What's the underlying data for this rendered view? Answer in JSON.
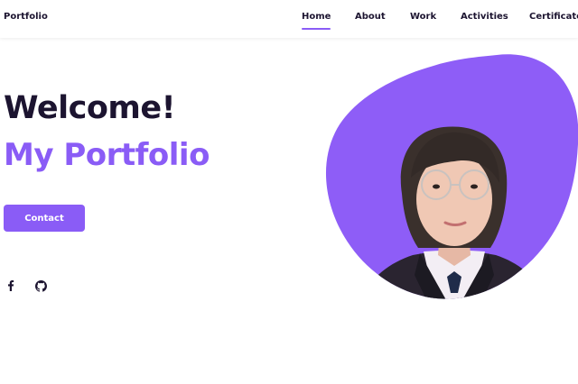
{
  "header": {
    "brand": "Portfolio",
    "nav": [
      {
        "label": "Home",
        "active": true
      },
      {
        "label": "About",
        "active": false
      },
      {
        "label": "Work",
        "active": false
      },
      {
        "label": "Activities",
        "active": false
      },
      {
        "label": "Certificate",
        "active": false
      }
    ]
  },
  "hero": {
    "greeting": "Welcome!",
    "subtitle": "My Portfolio",
    "contact_label": "Contact",
    "blob_color": "#8a5cf6",
    "accent_color": "#8a5cf6"
  },
  "social": [
    {
      "icon": "facebook-icon"
    },
    {
      "icon": "github-icon"
    }
  ]
}
